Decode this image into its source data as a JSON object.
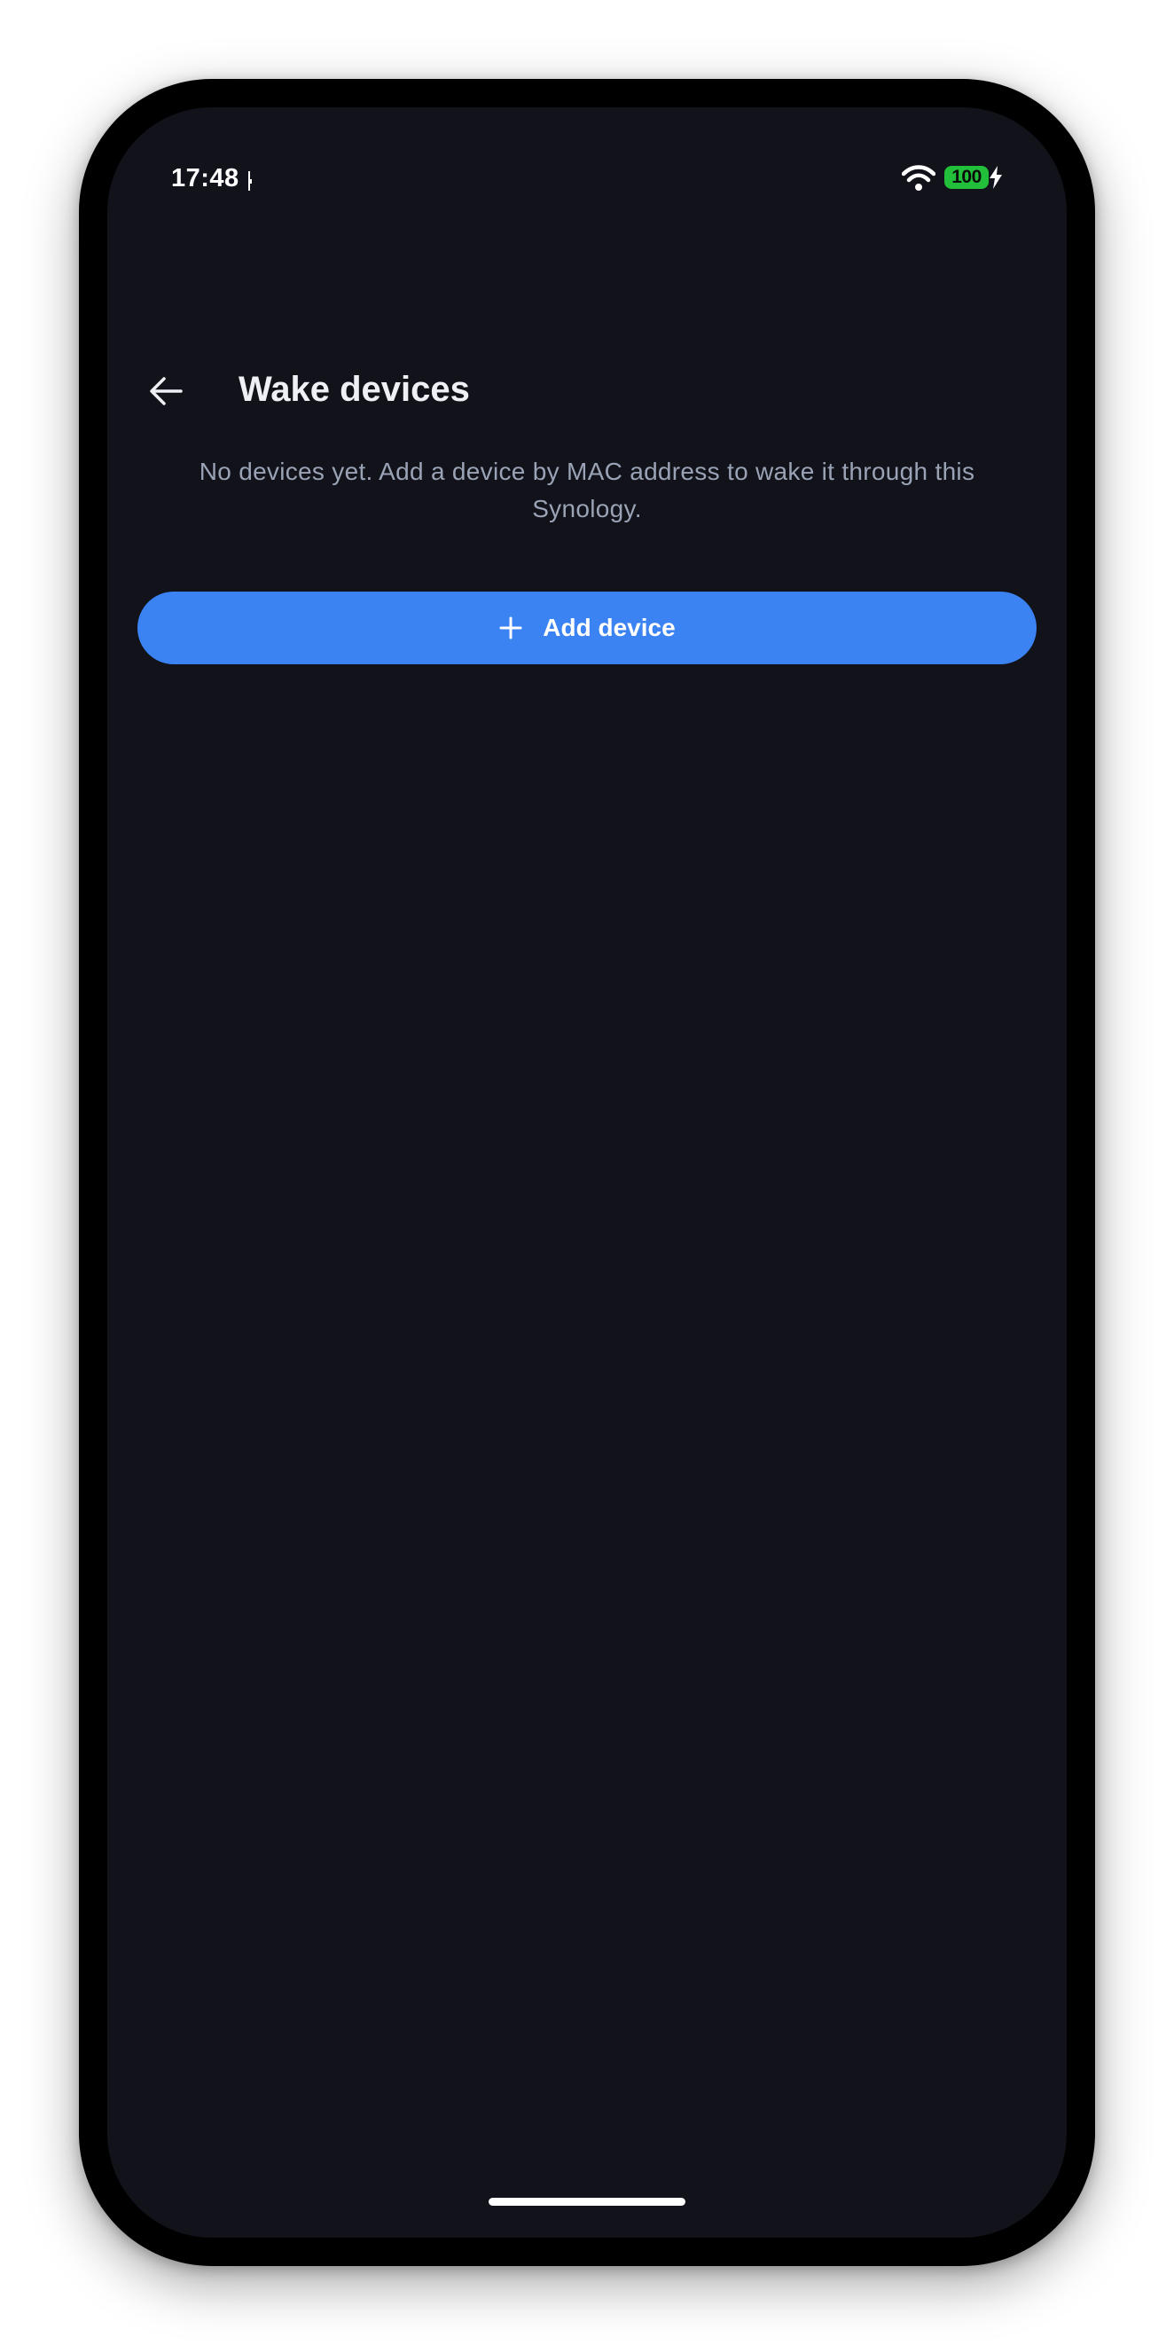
{
  "status_bar": {
    "time": "17:48",
    "battery_level": "100"
  },
  "app_bar": {
    "title": "Wake devices",
    "back_icon": "arrow-left-icon"
  },
  "empty_state": {
    "message": "No devices yet. Add a device by MAC address to wake it through this Synology."
  },
  "actions": {
    "add_device_label": "Add device",
    "add_icon": "plus-icon"
  },
  "colors": {
    "background": "#11121a",
    "accent": "#3b82f3",
    "battery": "#22c03a",
    "title_text": "#eef0f6",
    "muted_text": "#9aa3b5"
  }
}
